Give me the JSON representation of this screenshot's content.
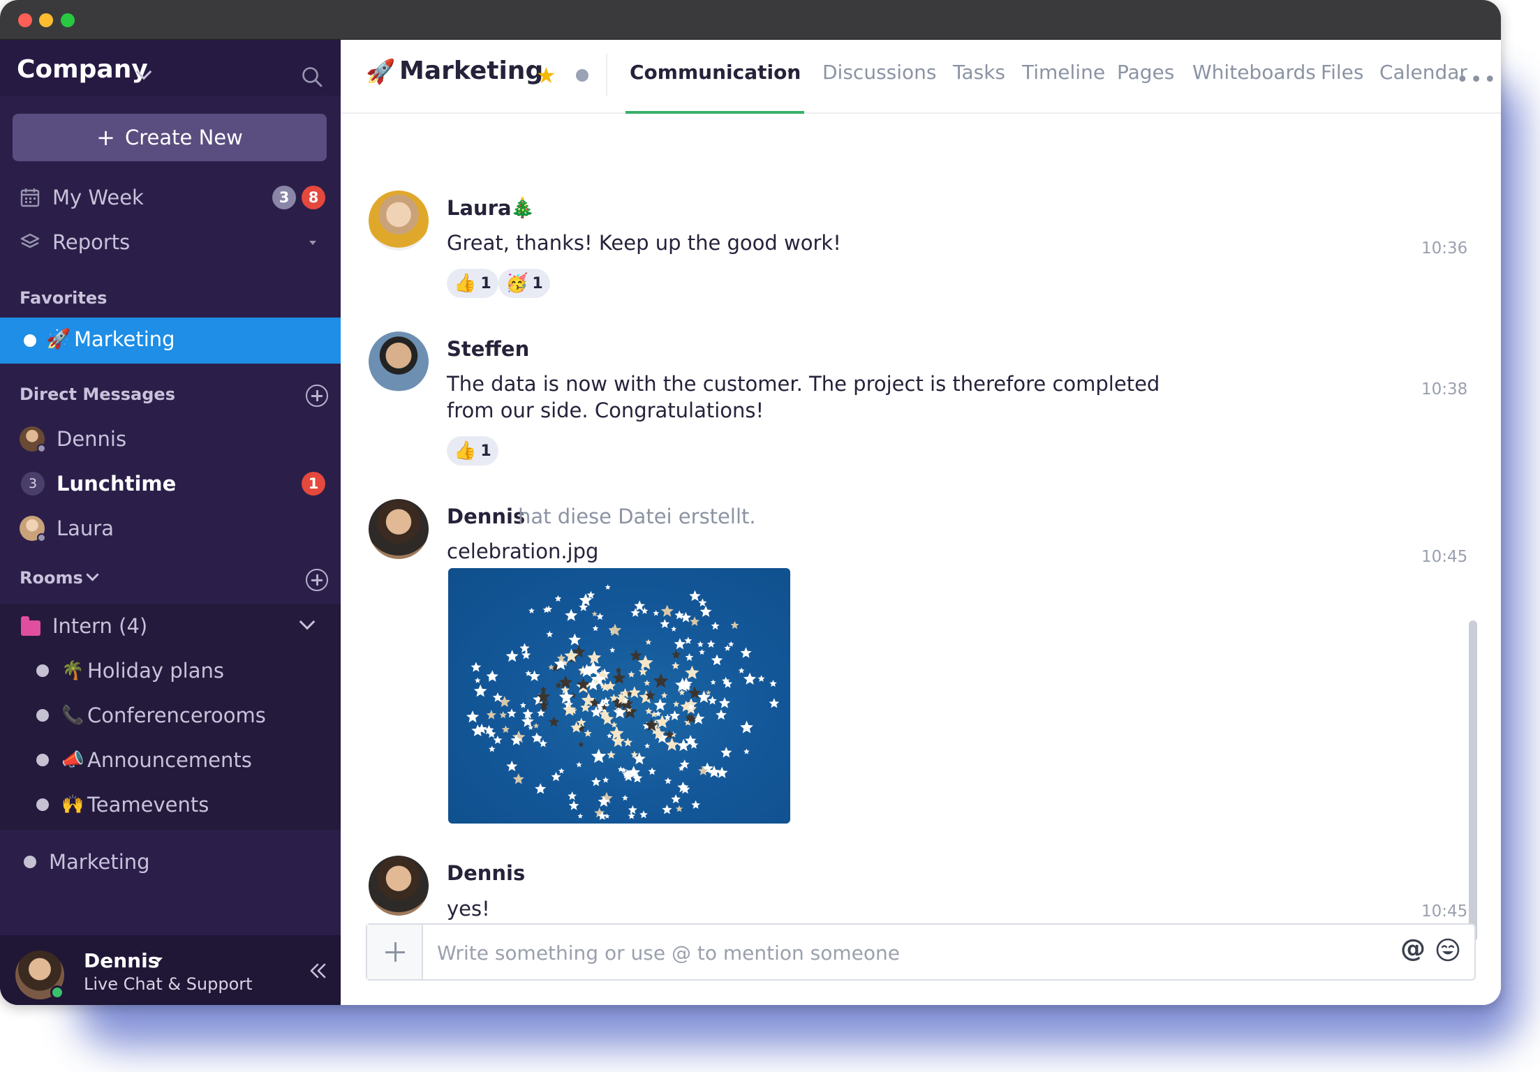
{
  "window": {
    "traffic_lights": [
      "close",
      "minimize",
      "zoom"
    ]
  },
  "sidebar": {
    "workspace": "Company",
    "create_new": "Create New",
    "nav": [
      {
        "label": "My Week",
        "icon": "calendar-icon",
        "badges": [
          "3",
          "8"
        ]
      },
      {
        "label": "Reports",
        "icon": "layers-icon"
      }
    ],
    "favorites_title": "Favorites",
    "favorites": [
      {
        "label": "Marketing",
        "emoji": "🚀",
        "active": true
      }
    ],
    "direct_messages_title": "Direct Messages",
    "direct_messages": [
      {
        "label": "Dennis"
      },
      {
        "label": "Lunchtime",
        "member_count": "3",
        "unread": "1"
      },
      {
        "label": "Laura"
      }
    ],
    "rooms_title": "Rooms",
    "rooms_group": {
      "label": "Intern (4)"
    },
    "rooms": [
      {
        "label": "Holiday plans",
        "emoji": "🌴"
      },
      {
        "label": "Conferencerooms",
        "emoji": "📞"
      },
      {
        "label": "Announcements",
        "emoji": "📣"
      },
      {
        "label": "Teamevents",
        "emoji": "🙌"
      }
    ],
    "other_rooms": [
      {
        "label": "Marketing"
      }
    ],
    "footer": {
      "name": "Dennis",
      "status": "Live Chat & Support"
    }
  },
  "header": {
    "channel_emoji": "🚀",
    "channel": "Marketing",
    "star": "★",
    "tabs": [
      {
        "label": "Communication",
        "active": true
      },
      {
        "label": "Discussions"
      },
      {
        "label": "Tasks"
      },
      {
        "label": "Timeline"
      },
      {
        "label": "Pages"
      },
      {
        "label": "Whiteboards"
      },
      {
        "label": "Files"
      },
      {
        "label": "Calendar"
      }
    ],
    "more": "•••"
  },
  "messages": [
    {
      "author": "Laura",
      "author_emoji": "🎄",
      "text": "Great, thanks! Keep up the good work!",
      "time": "10:36",
      "reactions": [
        {
          "emoji": "👍",
          "count": "1"
        },
        {
          "emoji": "🥳",
          "count": "1"
        }
      ]
    },
    {
      "author": "Steffen",
      "text_lines": [
        "The data is now with the customer. The project is therefore completed",
        "from our side. Congratulations!"
      ],
      "time": "10:38",
      "reactions": [
        {
          "emoji": "👍",
          "count": "1"
        }
      ]
    },
    {
      "author": "Dennis",
      "author_extra": "hat diese Datei erstellt.",
      "text": "celebration.jpg",
      "time": "10:45",
      "attachment": "celebration.jpg"
    },
    {
      "author": "Dennis",
      "text": "yes!",
      "time": "10:45"
    }
  ],
  "composer": {
    "value": "",
    "placeholder": "Write something or use @ to mention someone",
    "mention_symbol": "@"
  },
  "colors": {
    "sidebar_bg": "#2b1f4a",
    "active_item": "#1e8ee6",
    "tab_underline": "#38b16a",
    "badge_red": "#e5483c",
    "star": "#f5b800",
    "online": "#38c16a"
  }
}
